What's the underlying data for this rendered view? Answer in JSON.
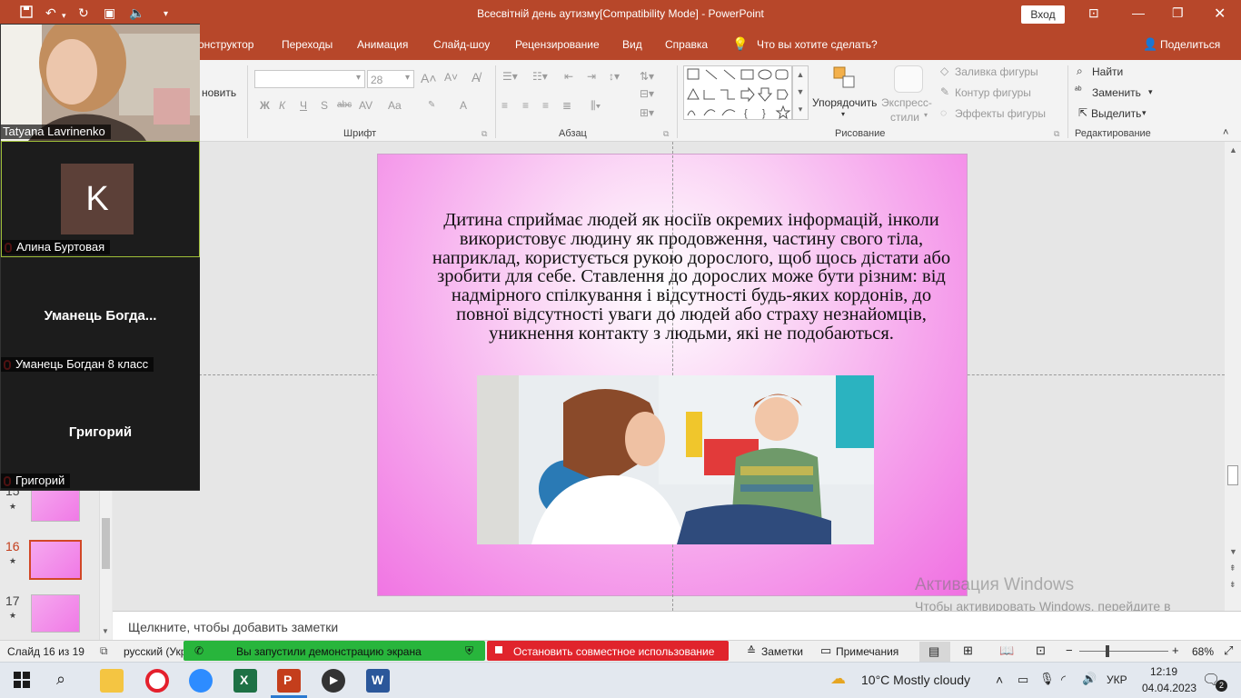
{
  "titlebar": {
    "title": "Всесвітній день аутизму[Compatibility Mode]  -  PowerPoint",
    "signin": "Вход"
  },
  "tabs": [
    "онструктор",
    "Переходы",
    "Анимация",
    "Слайд-шоу",
    "Рецензирование",
    "Вид",
    "Справка"
  ],
  "tell_me": "Что вы хотите сделать?",
  "share_label": "Поделиться",
  "ribbon": {
    "font_size_value": "28",
    "font_group": "Шрифт",
    "paragraph_group": "Абзац",
    "drawing_group": "Рисование",
    "editing_group": "Редактирование",
    "arrange": "Упорядочить",
    "quick_styles_1": "Экспресс-",
    "quick_styles_2": "стили",
    "shape_fill": "Заливка фигуры",
    "shape_outline": "Контур фигуры",
    "shape_effects": "Эффекты фигуры",
    "find": "Найти",
    "replace": "Заменить",
    "select": "Выделить",
    "partial_new": "новить",
    "font_btns": [
      "Ж",
      "К",
      "Ч",
      "S",
      "abc",
      "AV",
      "Aa",
      "A"
    ]
  },
  "slide": {
    "text": "Дитина сприймає людей як носіїв окремих інформацій, інколи використовує людину як продовження, частину свого тіла, наприклад, користується рукою дорослого, щоб щось дістати або зробити для себе. Ставлення до дорослих може бути різним: від надмірного спілкування і відсутності будь-яких кордонів, до повної відсутності уваги до людей або страху незнайомців, уникнення контакту з людьми, які не подобаються."
  },
  "thumbnails": [
    {
      "num": "15",
      "star": "★"
    },
    {
      "num": "16",
      "star": "★"
    },
    {
      "num": "17",
      "star": "★"
    }
  ],
  "notes_placeholder": "Щелкните, чтобы добавить заметки",
  "activation": {
    "title": "Активация Windows",
    "text": "Чтобы активировать Windows, перейдите в раздел \"Параметры\"."
  },
  "status": {
    "slide_counter": "Слайд 16 из 19",
    "language": "русский (Укр",
    "sharing": "Вы запустили демонстрацию экрана",
    "stop_sharing": "Остановить совместное использование",
    "notes": "Заметки",
    "comments": "Примечания",
    "zoom": "68%"
  },
  "zoom": {
    "participants": [
      {
        "name": "Tatyana Lavrinenko"
      },
      {
        "name": "Алина Буртовая",
        "avatar_letter": "K"
      },
      {
        "name": "Уманець Богдан 8 класс",
        "display": "Уманець  Богда..."
      },
      {
        "name": "Григорий",
        "display": "Григорий"
      }
    ]
  },
  "taskbar": {
    "weather": "10°C  Mostly cloudy",
    "lang": "УКР",
    "time": "12:19",
    "date": "04.04.2023",
    "notif_count": "2"
  },
  "colors": {
    "accent": "#b7472a",
    "share_green": "#28b53c",
    "stop_red": "#e0242c"
  }
}
